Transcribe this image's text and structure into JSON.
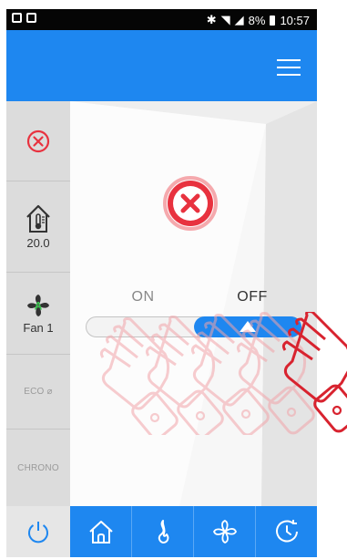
{
  "status_bar": {
    "icons_left": [
      "gallery-icon",
      "image-icon"
    ],
    "icons_right": [
      "bluetooth-icon",
      "wifi-icon",
      "signal-icon"
    ],
    "battery": "8%",
    "time": "10:57"
  },
  "app_bar": {
    "menu_icon": "hamburger-menu-icon"
  },
  "rail": {
    "status_icon": "close-circle-icon",
    "thermo_icon": "house-thermometer-icon",
    "temperature": "20.0",
    "fan_icon": "fan-icon",
    "fan_label": "Fan 1",
    "eco_label": "ECO",
    "chrono_label": "CHRONO"
  },
  "main": {
    "power_state_icon": "power-off-icon",
    "on_label": "ON",
    "off_label": "OFF",
    "switch_value": "OFF"
  },
  "bottom_nav": [
    {
      "icon": "power-icon"
    },
    {
      "icon": "home-icon"
    },
    {
      "icon": "flame-icon"
    },
    {
      "icon": "fan-icon"
    },
    {
      "icon": "clock-icon"
    }
  ],
  "colors": {
    "primary_blue": "#1e87f0",
    "off_red": "#e8323f",
    "status_bar": "#050505"
  }
}
